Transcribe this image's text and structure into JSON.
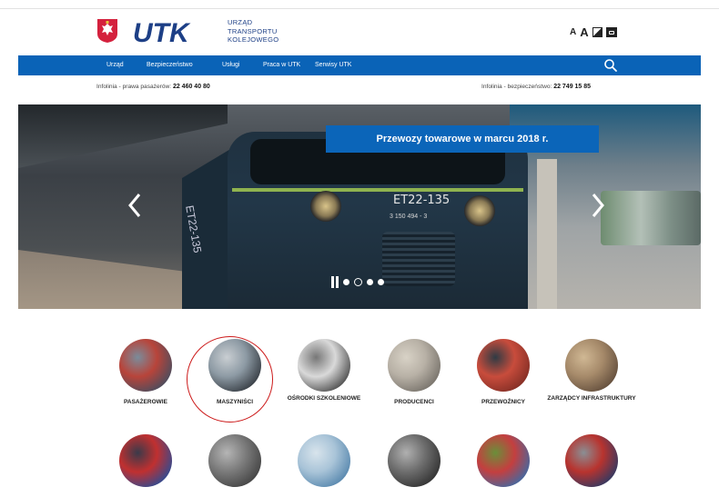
{
  "header": {
    "org_name_lines": [
      "URZĄD",
      "TRANSPORTU",
      "KOLEJOWEGO"
    ],
    "logo_text": "UTK",
    "font_small": "A",
    "font_large": "A"
  },
  "nav": {
    "items": [
      {
        "label": "Urząd"
      },
      {
        "label": "Bezpieczeństwo"
      },
      {
        "label": "Usługi"
      },
      {
        "label": "Praca w UTK"
      },
      {
        "label": "Serwisy UTK"
      }
    ]
  },
  "infobar": {
    "left_label": "Infolinia - prawa pasażerów:",
    "left_phone": "22 460 40 80",
    "right_label": "Infolinia - bezpieczeństwo:",
    "right_phone": "22 749 15 85"
  },
  "hero": {
    "headline": "Przewozy towarowe w marcu 2018 r.",
    "train_code": "ET22-135",
    "train_number": "3 150 494 - 3",
    "side_code": "ET22-135",
    "slide_count": 4,
    "active_slide": 2
  },
  "categories": [
    {
      "label": "PASAŻEROWIE",
      "colors": [
        "#3a4e63",
        "#b8443a",
        "#7a8c9b"
      ]
    },
    {
      "label": "MASZYNIŚCI",
      "colors": [
        "#2b3036",
        "#8d9aa4",
        "#c9ced2"
      ],
      "highlighted": true
    },
    {
      "label": "OŚRODKI SZKOLENIOWE",
      "colors": [
        "#3a3a3a",
        "#d9d9d9",
        "#777"
      ]
    },
    {
      "label": "PRODUCENCI",
      "colors": [
        "#6f6a63",
        "#b8b1a6",
        "#d8d2c6"
      ]
    },
    {
      "label": "PRZEWOŹNICY",
      "colors": [
        "#7a2a22",
        "#c84c3c",
        "#2f3b44"
      ]
    },
    {
      "label": "ZARZĄDCY INFRASTRUKTURY",
      "colors": [
        "#5a4636",
        "#a68a6a",
        "#d0b894"
      ]
    }
  ],
  "categories_row2": [
    {
      "colors": [
        "#1b4fa0",
        "#c03030",
        "#3a3a4a"
      ]
    },
    {
      "colors": [
        "#3c3c3c",
        "#7a7a7a",
        "#b5b5b5"
      ]
    },
    {
      "colors": [
        "#4c7fa8",
        "#a9c4d8",
        "#d8e4ec"
      ]
    },
    {
      "colors": [
        "#2a2a2a",
        "#6d6d6d",
        "#b0b0b0"
      ]
    },
    {
      "colors": [
        "#2f6fb0",
        "#c43f3f",
        "#6a8f3a"
      ]
    },
    {
      "colors": [
        "#1e3a6a",
        "#b8332e",
        "#8a8f94"
      ]
    }
  ],
  "colors": {
    "brand_blue": "#0a63b7",
    "headline_blue": "#0b65b9",
    "logo_navy": "#1d3f86",
    "highlight_red": "#cc1a1a"
  }
}
